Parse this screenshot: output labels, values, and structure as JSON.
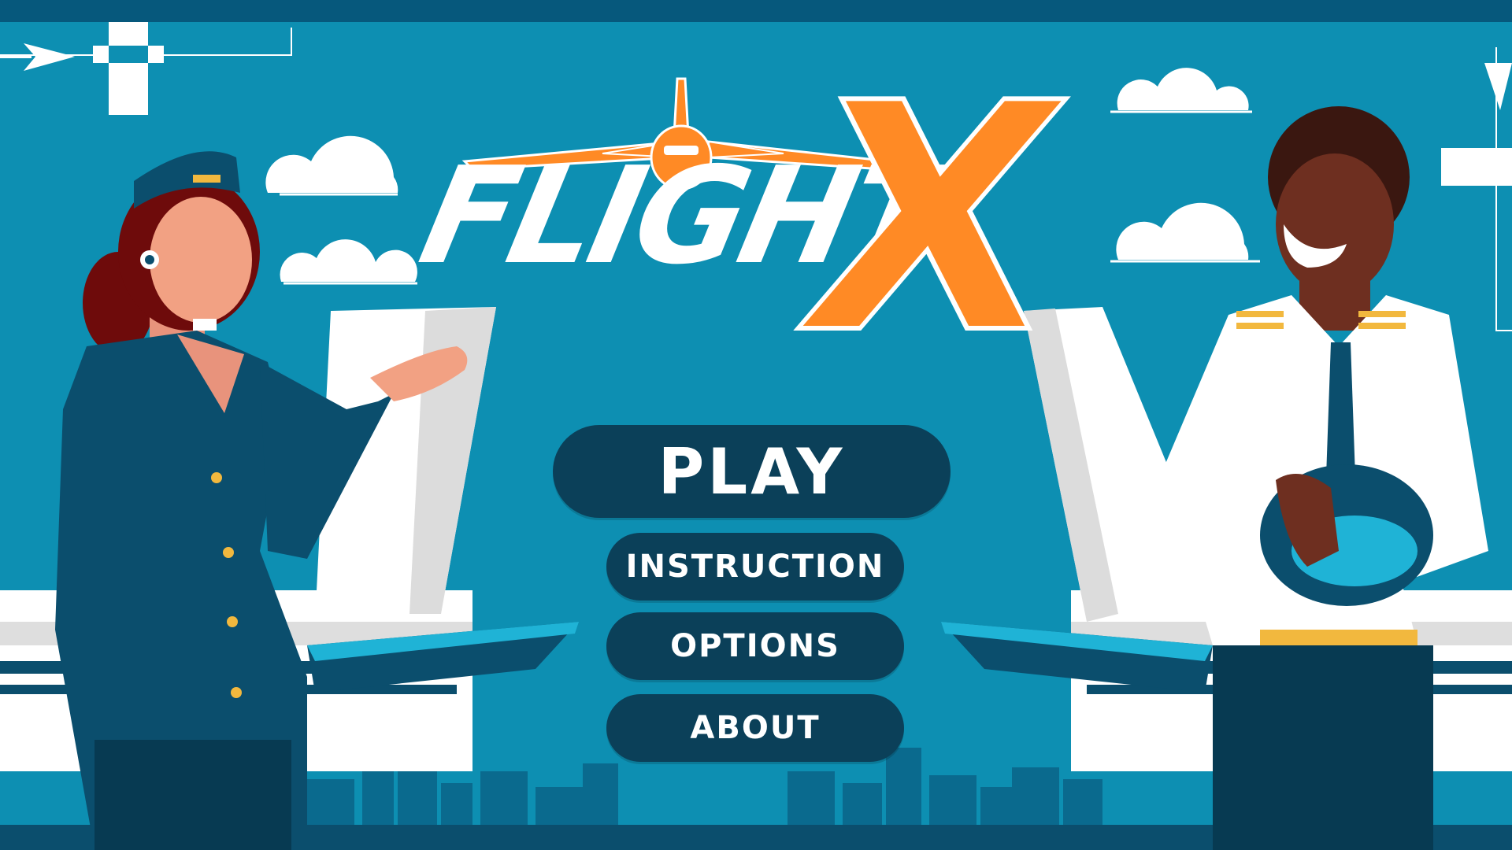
{
  "game": {
    "title_word": "FLIGHT",
    "title_letter": "X"
  },
  "menu": {
    "play": "PLAY",
    "instruction": "INSTRUCTION",
    "options": "OPTIONS",
    "about": "ABOUT"
  },
  "colors": {
    "sky": "#0d8fb2",
    "top_bar": "#06587c",
    "button_bg": "#0b4059",
    "button_text": "#ffffff",
    "accent_orange": "#ff8a25",
    "city_silhouette": "#0a6a8e"
  },
  "icons": {
    "left_cross": "crosshair-cross-icon",
    "right_cross": "crosshair-cross-icon",
    "left_arrow": "arrow-right-icon",
    "right_arrow": "arrow-down-icon",
    "logo_plane": "airplane-icon"
  }
}
